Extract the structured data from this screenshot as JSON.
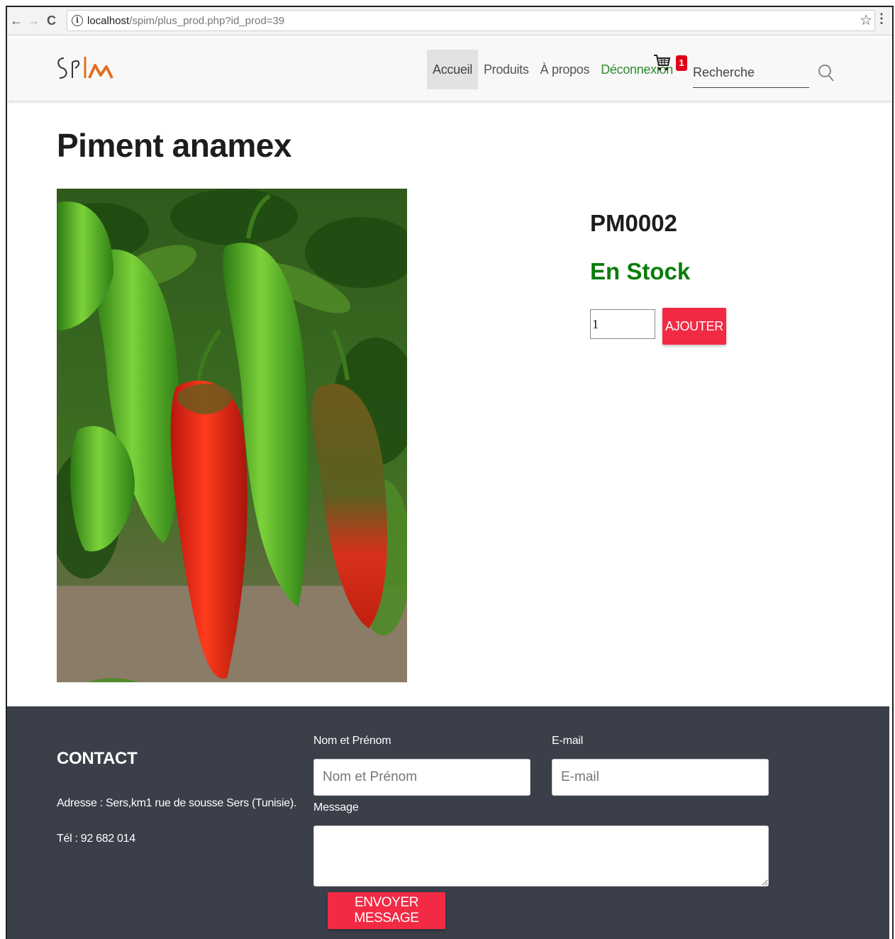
{
  "browser": {
    "url_host": "localhost",
    "url_path": "/spim/plus_prod.php?id_prod=39"
  },
  "navbar": {
    "logo_text": "SPIM",
    "links": [
      {
        "label": "Accueil"
      },
      {
        "label": "Produits"
      },
      {
        "label": "À propos"
      },
      {
        "label": "Déconnexion"
      }
    ],
    "cart_count": "1",
    "search_placeholder": "Recherche"
  },
  "product": {
    "title": "Piment anamex",
    "reference": "PM0002",
    "stock_status": "En Stock",
    "quantity": "1",
    "add_label": "AJOUTER"
  },
  "footer": {
    "contact_heading": "CONTACT",
    "address": "Adresse : Sers,km1 rue de sousse Sers (Tunisie).",
    "phone": "Tél : 92 682 014",
    "form": {
      "name_label": "Nom et Prénom",
      "name_placeholder": "Nom et Prénom",
      "email_label": "E-mail",
      "email_placeholder": "E-mail",
      "message_label": "Message",
      "send_label": "ENVOYER MESSAGE"
    }
  },
  "colors": {
    "accent": "#f22a44",
    "stock": "#0a7d0a",
    "footer_bg": "#3b3f4a",
    "logout_link": "#2e8b2e"
  }
}
